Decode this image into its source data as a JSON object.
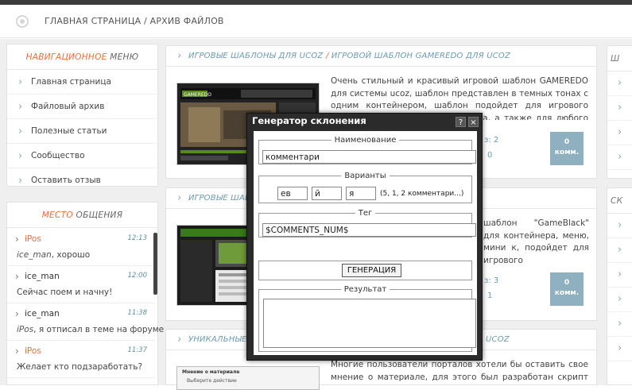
{
  "header": {
    "breadcrumb": "ГЛАВНАЯ СТРАНИЦА / АРХИВ ФАЙЛОВ"
  },
  "nav_menu": {
    "title_accent": "НАВИГАЦИОННОЕ",
    "title_rest": " МЕНЮ",
    "items": [
      "Главная страница",
      "Файловый архив",
      "Полезные статьи",
      "Сообщество",
      "Оставить отзыв"
    ]
  },
  "chat": {
    "title_accent": "МЕСТО",
    "title_rest": " ОБЩЕНИЯ",
    "messages": [
      {
        "user": "iPos",
        "time": "12:13",
        "quote": "ice_man",
        "text": ", хорошо"
      },
      {
        "user": "ice_man",
        "time": "12:00",
        "quote": "",
        "text": "Сейчас поем и начну!"
      },
      {
        "user": "ice_man",
        "time": "11:38",
        "quote": "iPos",
        "text": ", я отписал в теме на форуме"
      },
      {
        "user": "iPos",
        "time": "11:37",
        "quote": "",
        "text": "Желает кто подзаработать?"
      }
    ]
  },
  "articles": [
    {
      "cat": "ИГРОВЫЕ ШАБЛОНЫ ДЛЯ UCOZ",
      "sep": " / ",
      "title": "ИГРОВОЙ ШАБЛОН GAMEREDO ДЛЯ UCOZ",
      "text": "Очень стильный и красивый игровой шаблон GAMEREDO для системы ucoz, шаблон представлен в темных тонах с одним контейнером, шаблон подойдет для игрового сообщества или игрового портала, а также для любого портала.",
      "meta1": "з: 2",
      "meta2": "0",
      "comm_count": "0",
      "comm_label": "комм."
    },
    {
      "cat": "ИГРОВЫЕ ШАБЛО",
      "text": "шаблон \"GameBlack\" для контейнера, меню, мини к, подойдет для игрового",
      "meta1": "з: 3",
      "meta2": "1",
      "comm_count": "0",
      "comm_label": "комм."
    },
    {
      "cat": "УНИКАЛЬНЫЕ МО",
      "title_tail": "UCOZ",
      "text": "Многие пользователи порталов хотели бы оставить свое мнение о материале, для этого был разработан скрипт \"мнение о",
      "thumb_title": "Мнение о материале",
      "thumb_sub": "Выберите действие"
    }
  ],
  "right_panel": {
    "title1": "Ш",
    "title2": "СК"
  },
  "thumb1_logo": "GAMEREDO",
  "modal": {
    "title": "Генератор склонения",
    "help": "?",
    "close": "×",
    "name_legend": "Наименование",
    "name_value": "комментари",
    "variants_legend": "Варианты",
    "v1": "ев",
    "v2": "й",
    "v3": "я",
    "variants_hint": "(5, 1, 2 комментари...)",
    "tag_legend": "Тег",
    "tag_value": "$COMMENTS_NUM$",
    "generate": "ГЕНЕРАЦИЯ",
    "result_legend": "Результат",
    "result_value": ""
  }
}
